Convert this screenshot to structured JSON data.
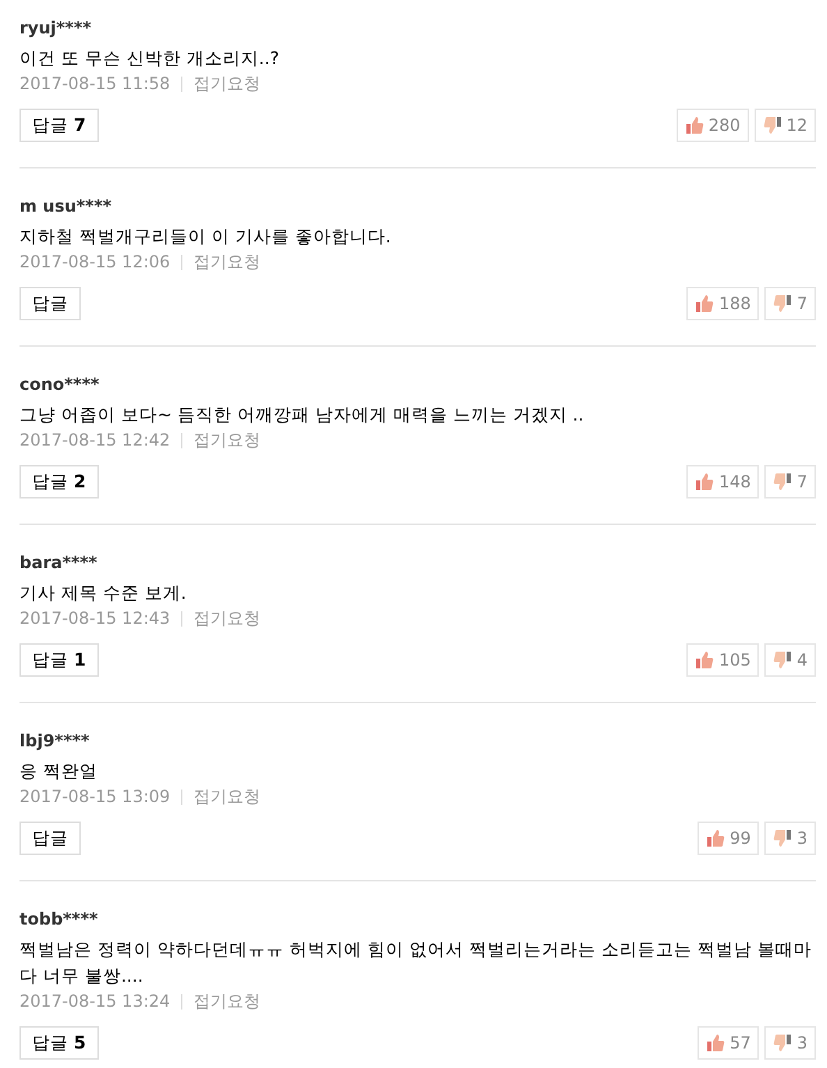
{
  "comments": [
    {
      "user": "ryuj****",
      "text": "이건 또 무슨 신박한 개소리지..?",
      "date": "2017-08-15 11:58",
      "fold": "접기요청",
      "reply": {
        "label": "답글",
        "count": "7"
      },
      "likes": "280",
      "dislikes": "12"
    },
    {
      "user": "m usu****",
      "text": "지하철 쩍벌개구리들이 이 기사를 좋아합니다.",
      "date": "2017-08-15 12:06",
      "fold": "접기요청",
      "reply": {
        "label": "답글"
      },
      "likes": "188",
      "dislikes": "7"
    },
    {
      "user": "cono****",
      "text": "그냥 어좁이 보다~ 듬직한 어깨깡패 남자에게 매력을 느끼는 거겠지 ..",
      "date": "2017-08-15 12:42",
      "fold": "접기요청",
      "reply": {
        "label": "답글",
        "count": "2"
      },
      "likes": "148",
      "dislikes": "7"
    },
    {
      "user": "bara****",
      "text": "기사 제목 수준 보게.",
      "date": "2017-08-15 12:43",
      "fold": "접기요청",
      "reply": {
        "label": "답글",
        "count": "1"
      },
      "likes": "105",
      "dislikes": "4"
    },
    {
      "user": "lbj9****",
      "text": "응 쩍완얼",
      "date": "2017-08-15 13:09",
      "fold": "접기요청",
      "reply": {
        "label": "답글"
      },
      "likes": "99",
      "dislikes": "3"
    },
    {
      "user": "tobb****",
      "text": "쩍벌남은 정력이 약하다던데ㅠㅠ 허벅지에 힘이 없어서 쩍벌리는거라는 소리듣고는 쩍벌남 볼때마다 너무 불쌍....",
      "date": "2017-08-15 13:24",
      "fold": "접기요청",
      "reply": {
        "label": "답글",
        "count": "5"
      },
      "likes": "57",
      "dislikes": "3"
    }
  ]
}
